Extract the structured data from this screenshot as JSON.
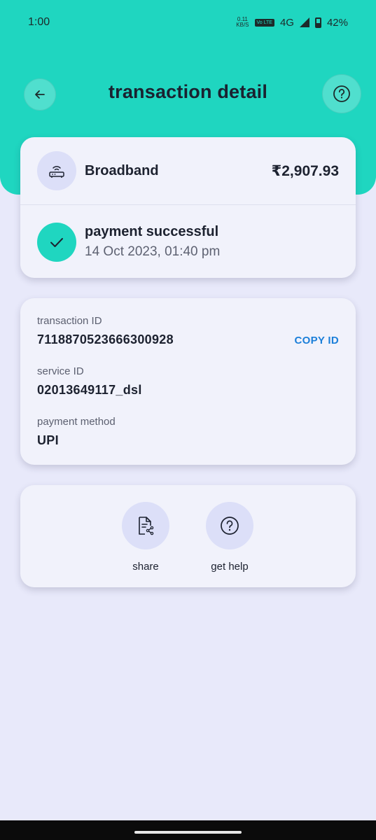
{
  "status_bar": {
    "time": "1:00",
    "speed_value": "0.11",
    "speed_unit": "KB/S",
    "volte": "Vo LTE",
    "network": "4G",
    "battery": "42%"
  },
  "header": {
    "title": "transaction detail"
  },
  "summary": {
    "biller": "Broadband",
    "amount": "₹2,907.93",
    "status": "payment successful",
    "datetime": "14 Oct 2023, 01:40 pm"
  },
  "details": {
    "transaction_id_label": "transaction ID",
    "transaction_id": "7118870523666300928",
    "copy_label": "COPY ID",
    "service_id_label": "service ID",
    "service_id": "02013649117_dsl",
    "payment_method_label": "payment method",
    "payment_method": "UPI"
  },
  "actions": {
    "share": "share",
    "get_help": "get help"
  },
  "colors": {
    "accent": "#1fd6c0",
    "link": "#1b7fd9",
    "background": "#e8e9fa"
  }
}
